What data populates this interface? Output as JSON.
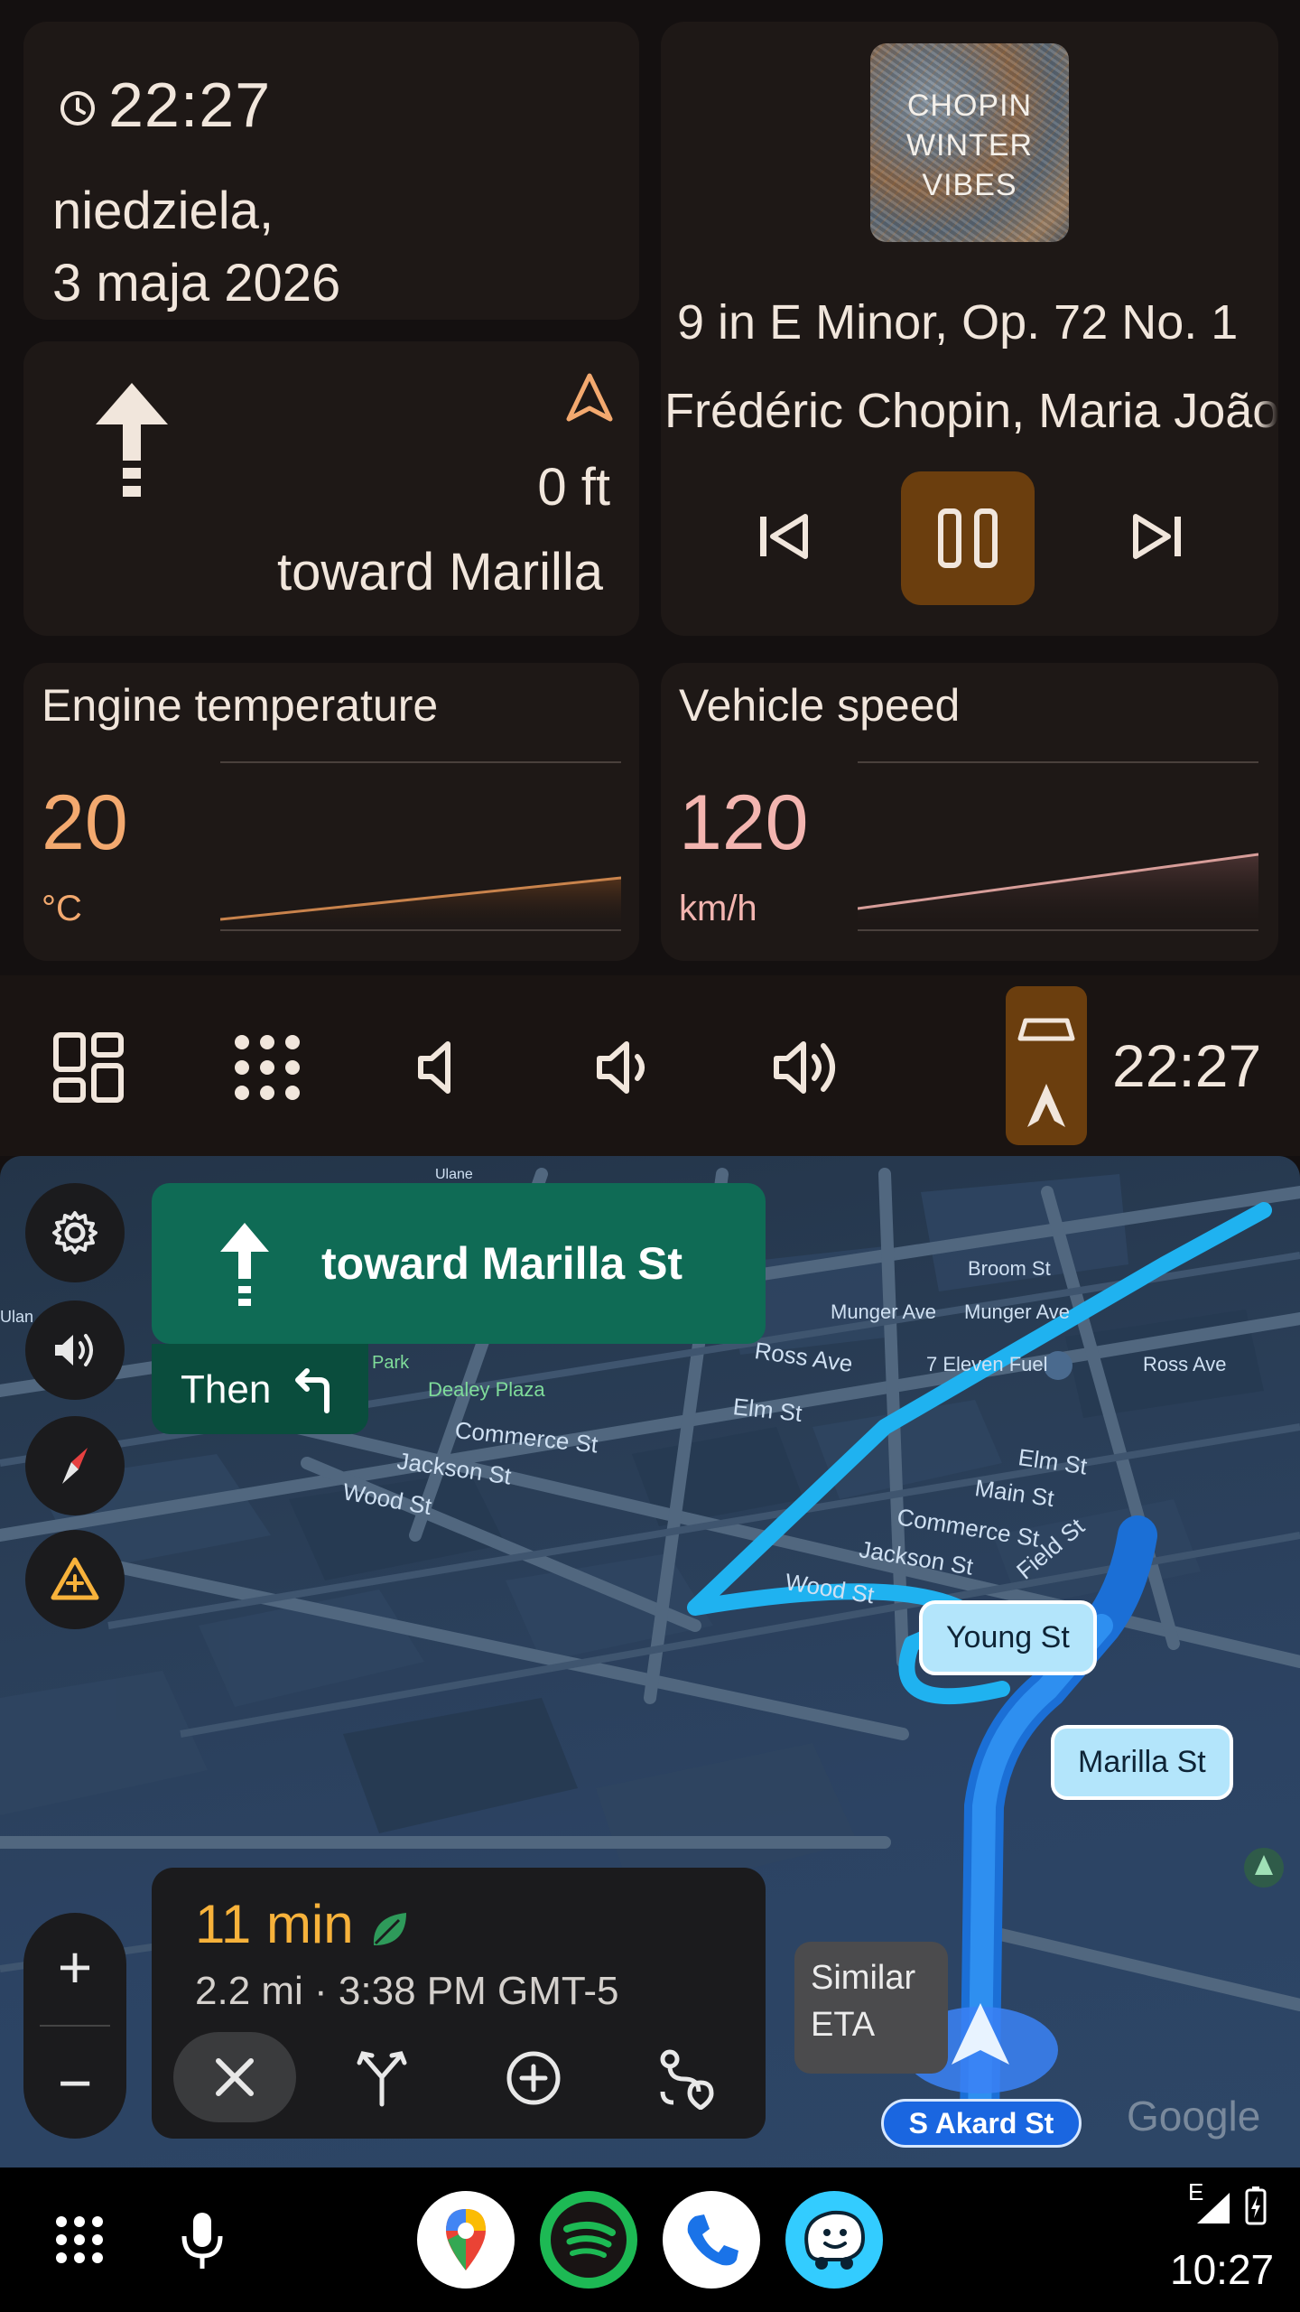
{
  "clock_widget": {
    "time": "22:27",
    "date_line1": "niedziela,",
    "date_line2": "3 maja 2026"
  },
  "nav_widget": {
    "distance": "0 ft",
    "toward": "toward Marilla"
  },
  "media_widget": {
    "album_lines": [
      "CHOPIN",
      "WINTER",
      "VIBES"
    ],
    "track_title": "9 in E Minor, Op. 72 No. 1",
    "track_artist": "Frédéric Chopin, Maria João"
  },
  "engine_widget": {
    "title": "Engine temperature",
    "value": "20",
    "unit": "°C",
    "accent": "#f3a96f"
  },
  "speed_widget": {
    "title": "Vehicle speed",
    "value": "120",
    "unit": "km/h",
    "accent": "#f3b5b0"
  },
  "control_bar": {
    "time": "22:27",
    "icons": [
      "dashboard-icon",
      "app-grid-icon",
      "volume-mute-icon",
      "volume-low-icon",
      "volume-high-icon",
      "car-icon",
      "navigation-icon"
    ]
  },
  "map": {
    "banner_text": "toward Marilla St",
    "then_label": "Then",
    "street_labels": [
      "Broom St",
      "Munger Ave",
      "Munger Ave",
      "Ross Ave",
      "7 Eleven Fuel",
      "Ross Ave",
      "Elm St",
      "Dealey Plaza",
      "Commerce St",
      "Jackson St",
      "Wood St",
      "Elm St",
      "Main St",
      "Commerce St",
      "Jackson St",
      "Wood St",
      "Field St",
      "Park",
      "Ulane",
      "Ulan"
    ],
    "bubble_young": "Young St",
    "bubble_marilla": "Marilla St",
    "eta_minutes": "11 min",
    "eta_details": "2.2 mi · 3:38 PM GMT-5",
    "similar_eta": "Similar ETA",
    "current_street": "S Akard St",
    "google": "Google",
    "zoom_in": "+",
    "zoom_out": "−"
  },
  "dock": {
    "time": "10:27",
    "status_network": "E",
    "apps": [
      "google-maps-icon",
      "spotify-icon",
      "phone-icon",
      "waze-icon"
    ]
  }
}
